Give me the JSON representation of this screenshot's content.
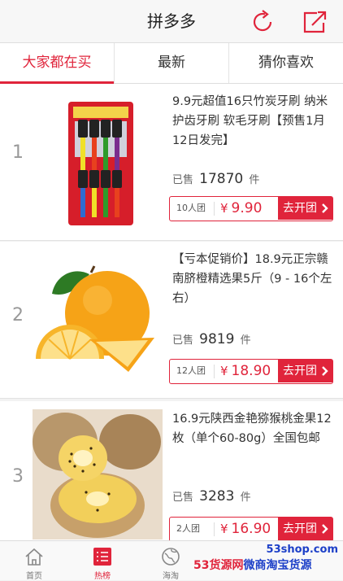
{
  "header": {
    "title": "拼多多",
    "refresh_icon": "refresh-icon",
    "share_icon": "share-icon"
  },
  "tabs": [
    {
      "label": "大家都在买",
      "active": true
    },
    {
      "label": "最新",
      "active": false
    },
    {
      "label": "猜你喜欢",
      "active": false
    }
  ],
  "products": [
    {
      "rank": "1",
      "title": "9.9元超值16只竹炭牙刷 纳米护齿牙刷 软毛牙刷【预售1月12日发完】",
      "sold_prefix": "已售",
      "sold_count": "17870",
      "sold_suffix": "件",
      "group_size": "10人团",
      "currency": "¥",
      "price": "9.90",
      "button_label": "去开团"
    },
    {
      "rank": "2",
      "title": "【亏本促销价】18.9元正宗赣南脐橙精选果5斤（9 - 16个左右）",
      "sold_prefix": "已售",
      "sold_count": "9819",
      "sold_suffix": "件",
      "group_size": "12人团",
      "currency": "¥",
      "price": "18.90",
      "button_label": "去开团"
    },
    {
      "rank": "3",
      "title": "16.9元陕西金艳猕猴桃金果12枚（单个60-80g）全国包邮",
      "sold_prefix": "已售",
      "sold_count": "3283",
      "sold_suffix": "件",
      "group_size": "2人团",
      "currency": "¥",
      "price": "16.90",
      "button_label": "去开团"
    }
  ],
  "tabbar": [
    {
      "label": "首页",
      "icon": "home-icon",
      "active": false
    },
    {
      "label": "热榜",
      "icon": "hot-list-icon",
      "active": true
    },
    {
      "label": "海淘",
      "icon": "globe-icon",
      "active": false
    },
    {
      "label": "",
      "icon": "",
      "active": false
    },
    {
      "label": "",
      "icon": "",
      "active": false
    }
  ],
  "watermark": {
    "url": "53shop.com",
    "text_a": "53货源网",
    "text_b": "微商淘宝货源"
  },
  "colors": {
    "accent": "#e0243b",
    "header_bg": "#f7f7f7"
  }
}
